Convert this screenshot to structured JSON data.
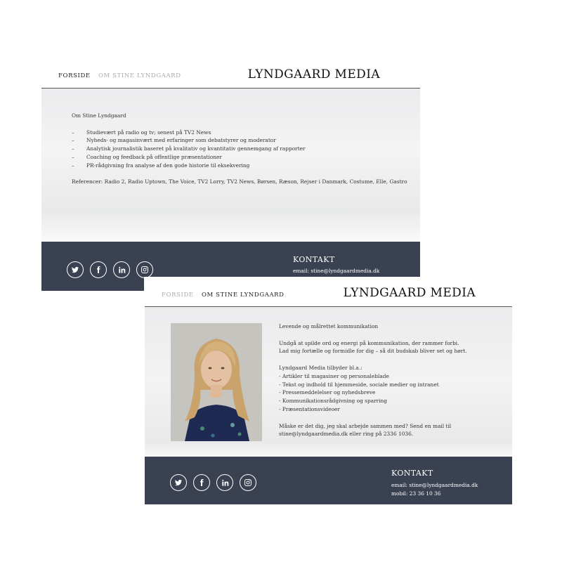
{
  "card1": {
    "nav": [
      "FORSIDE",
      "OM STINE LYNDGAARD"
    ],
    "brand": "LYNDGAARD MEDIA",
    "heading": "Om Stine Lyndgaard",
    "bullets": [
      "Studievært på radio og tv; senest på TV2 News",
      "Nyheds- og magasinvært med erfaringer som debatstyrer og moderator",
      "Analytisk journalistik baseret på kvalitativ og kvantitativ gennemgang af rapporter",
      "Coaching og feedback på offentlige præsentationer",
      "PR-rådgivning fra analyse af den gode historie til eksekvering"
    ],
    "references": "Referencer: Radio 2, Radio Uptown, The Voice, TV2 Lorry, TV2 News, Børsen, Ræson, Rejser i Danmark, Costume, Elle, Gastro",
    "footer": {
      "kontakt": "KONTAKT",
      "email": "email: stine@lyndgaardmedia.dk",
      "social_icons": [
        "twitter-icon",
        "facebook-icon",
        "linkedin-icon",
        "instagram-icon"
      ]
    }
  },
  "card2": {
    "nav": [
      "FORSIDE",
      "OM STINE LYNDGAARD"
    ],
    "brand": "LYNDGAARD MEDIA",
    "heading": "Levende og målrettet kommunikation",
    "para1": [
      "Undgå at spilde ord og energi på kommunikation, der rammer forbi.",
      "Lad mig fortælle og formidle for dig – så dit budskab bliver set og hørt."
    ],
    "offer_title": "Lyndgaard Media tilbyder bl.a.:",
    "offers": [
      "- Artikler til magasiner og personaleblade",
      "- Tekst og indhold til hjemmeside, sociale medier og intranet",
      "- Pressemeddelelser og nyhedsbreve",
      "- Kommunikationsrådgivning og sparring",
      "- Præsentationsvideoer"
    ],
    "closing": [
      "Måske er det dig, jeg skal arbejde sammen med? Send en mail til",
      "stine@lyndgaardmedia.dk eller ring på 2336 1036."
    ],
    "footer": {
      "kontakt": "KONTAKT",
      "email": "email: stine@lyndgaardmedia.dk",
      "mobile": "mobil: 23 36 10 36",
      "social_icons": [
        "twitter-icon",
        "facebook-icon",
        "linkedin-icon",
        "instagram-icon"
      ]
    }
  },
  "colors": {
    "footer": "#3a4150",
    "nav_dim": "#aaaaaa"
  }
}
